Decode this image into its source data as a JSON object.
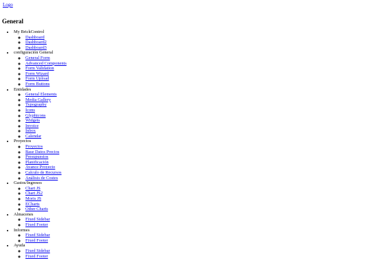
{
  "logo": "Logo",
  "section_title": "General",
  "menu": [
    {
      "label": "My BrickControl",
      "items": [
        "Dashboard",
        "Dashboard2",
        "Dashboard3"
      ]
    },
    {
      "label": "configuración General",
      "items": [
        "General Form",
        "Advanced Components",
        "Form Validation",
        "Form Wizard",
        "Form Upload",
        "Form Buttons"
      ]
    },
    {
      "label": "Entidades",
      "items": [
        "General Elements",
        "Media Gallery",
        "Typography",
        "Icons",
        "Glyphicons",
        "Widgets",
        "Invoice",
        "Inbox",
        "Calendar"
      ]
    },
    {
      "label": "Proyectos",
      "items": [
        "Proyectos",
        "Base Datos Precios",
        "Presupuestos",
        "Planificación",
        "Avance Proyecto",
        "Calculo de Recursos",
        "Análisis de Costes"
      ]
    },
    {
      "label": "Gastos/Ingresos",
      "items": [
        "Chart JS",
        "Chart JS2",
        "Moris JS",
        "ECharts",
        "Other Charts"
      ]
    },
    {
      "label": "Almacenes",
      "items": [
        "Fixed Sidebar",
        "Fixed Footer"
      ]
    },
    {
      "label": "Informes",
      "items": [
        "Fixed Sidebar",
        "Fixed Footer"
      ]
    },
    {
      "label": "Ayuda",
      "items": [
        "Fixed Sidebar",
        "Fixed Footer"
      ]
    }
  ]
}
